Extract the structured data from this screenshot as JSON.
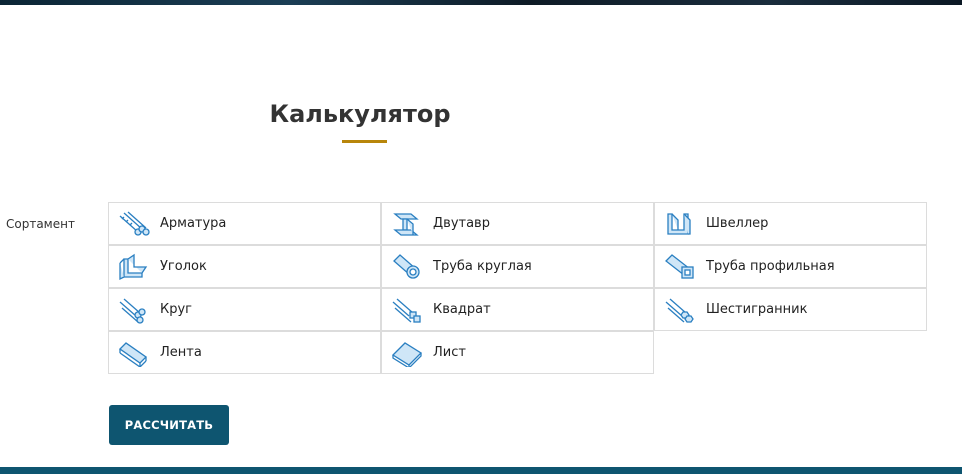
{
  "page": {
    "title": "Калькулятор"
  },
  "form": {
    "field_label": "Сортамент"
  },
  "colors": {
    "accent": "#b8860b",
    "primary": "#0e5570",
    "icon": "#2a7fc1"
  },
  "items": [
    {
      "label": "Арматура",
      "icon": "rebar-icon"
    },
    {
      "label": "Двутавр",
      "icon": "i-beam-icon"
    },
    {
      "label": "Швеллер",
      "icon": "channel-icon"
    },
    {
      "label": "Уголок",
      "icon": "angle-icon"
    },
    {
      "label": "Труба круглая",
      "icon": "round-pipe-icon"
    },
    {
      "label": "Труба профильная",
      "icon": "profile-pipe-icon"
    },
    {
      "label": "Круг",
      "icon": "round-bar-icon"
    },
    {
      "label": "Квадрат",
      "icon": "square-bar-icon"
    },
    {
      "label": "Шестигранник",
      "icon": "hexagon-bar-icon"
    },
    {
      "label": "Лента",
      "icon": "strip-icon"
    },
    {
      "label": "Лист",
      "icon": "sheet-icon"
    }
  ],
  "actions": {
    "calculate_label": "РАССЧИТАТЬ"
  }
}
